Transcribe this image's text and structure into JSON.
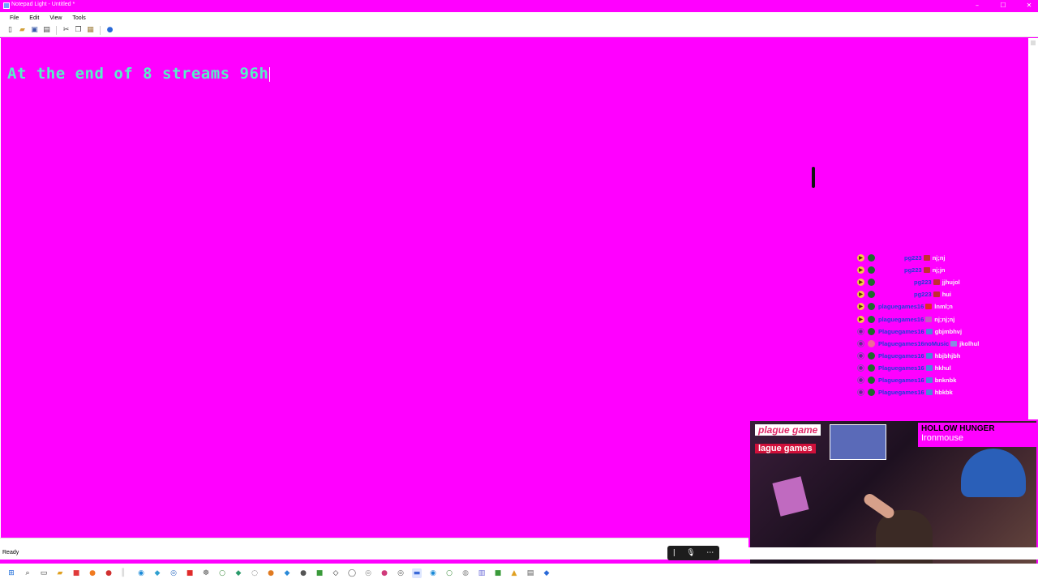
{
  "window": {
    "title": "Notepad Light - Untitled *",
    "controls": [
      "–",
      "☐",
      "✕"
    ]
  },
  "menu": [
    "File",
    "Edit",
    "View",
    "Tools"
  ],
  "toolbar": {
    "icons": [
      "new-file-icon",
      "open-folder-icon",
      "save-icon",
      "print-icon",
      "cut-icon",
      "copy-icon",
      "paste-icon",
      "help-icon"
    ]
  },
  "editor": {
    "text": "At the end of 8 streams 96h",
    "text_color": "#57f0c8",
    "background": "#ff00ff"
  },
  "status": {
    "text": "Ready"
  },
  "chat": {
    "messages": [
      {
        "platform": "youtube",
        "user": "pg223",
        "message": "nj;nj"
      },
      {
        "platform": "youtube",
        "user": "pg223",
        "message": "nj;jn"
      },
      {
        "platform": "youtube",
        "user": "pg223",
        "message": "jjhujol"
      },
      {
        "platform": "youtube",
        "user": "pg223",
        "message": "hui"
      },
      {
        "platform": "youtube",
        "user": "plaguegames16",
        "message": "lnml;n"
      },
      {
        "platform": "youtube",
        "user": "plaguegames16",
        "message": "nj;nj;nj"
      },
      {
        "platform": "twitch",
        "user": "Plaguegames16",
        "message": "gbjmbhvj"
      },
      {
        "platform": "twitch",
        "user": "Plaguegames16noMusic",
        "message": "jkolhul"
      },
      {
        "platform": "twitch",
        "user": "Plaguegames16",
        "message": "hbjbhjbh"
      },
      {
        "platform": "twitch",
        "user": "Plaguegames16",
        "message": "hkhul"
      },
      {
        "platform": "twitch",
        "user": "Plaguegames16",
        "message": "bnknbk"
      },
      {
        "platform": "twitch",
        "user": "Plaguegames16",
        "message": "hbkbk"
      }
    ]
  },
  "webcam": {
    "logo_top": "plague game",
    "logo_bottom": "lague games",
    "game_title": "HOLLOW HUNGER",
    "game_subtitle": "Ironmouse"
  },
  "mic_widget": {
    "icons": [
      "bar-icon",
      "microphone-icon",
      "more-icon"
    ]
  },
  "taskbar": {
    "icons": [
      "windows-start-icon",
      "search-icon",
      "task-view-icon",
      "file-explorer-icon",
      "folder-icon",
      "app-icon",
      "browser-icon",
      "chrome-icon",
      "edge-icon",
      "app-icon",
      "app-icon",
      "app-icon",
      "app-icon"
    ]
  }
}
